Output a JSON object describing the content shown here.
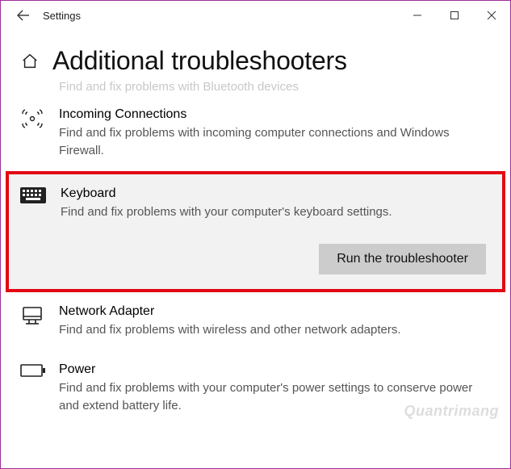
{
  "titlebar": {
    "title": "Settings"
  },
  "header": {
    "page_title": "Additional troubleshooters"
  },
  "cutoff_top": {
    "desc": "Find and fix problems with Bluetooth devices"
  },
  "items": {
    "incoming": {
      "title": "Incoming Connections",
      "desc": "Find and fix problems with incoming computer connections and Windows Firewall."
    },
    "keyboard": {
      "title": "Keyboard",
      "desc": "Find and fix problems with your computer's keyboard settings.",
      "run_label": "Run the troubleshooter"
    },
    "network": {
      "title": "Network Adapter",
      "desc": "Find and fix problems with wireless and other network adapters."
    },
    "power": {
      "title": "Power",
      "desc": "Find and fix problems with your computer's power settings to conserve power and extend battery life."
    }
  },
  "watermark": "Quantrimang"
}
